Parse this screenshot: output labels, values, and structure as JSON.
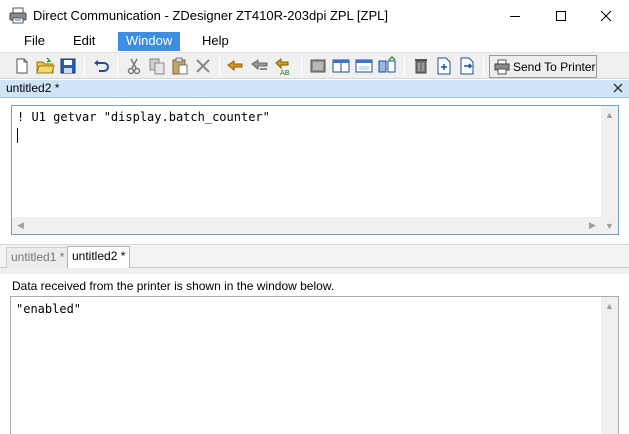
{
  "window": {
    "title": "Direct Communication - ZDesigner ZT410R-203dpi ZPL [ZPL]",
    "app_icon": "printer-icon"
  },
  "menu": {
    "items": [
      {
        "label": "File",
        "active": false
      },
      {
        "label": "Edit",
        "active": false
      },
      {
        "label": "Window",
        "active": true
      },
      {
        "label": "Help",
        "active": false
      }
    ]
  },
  "toolbar": {
    "buttons": [
      "new-icon",
      "open-icon",
      "save-icon",
      "undo-icon",
      "cut-icon",
      "copy-icon",
      "paste-icon",
      "delete-icon",
      "find-icon",
      "find-next-icon",
      "replace-icon",
      "layout-1-icon",
      "layout-2-icon",
      "layout-3-icon",
      "layout-4-icon",
      "clear-icon",
      "import-icon",
      "export-icon",
      "send-to-printer-icon"
    ],
    "send_label": "Send To Printer"
  },
  "document": {
    "title": "untitled2 *",
    "command_text": "! U1 getvar \"display.batch_counter\""
  },
  "tabs": [
    {
      "label": "untitled1 *",
      "active": false
    },
    {
      "label": "untitled2 *",
      "active": true
    }
  ],
  "output": {
    "label": "Data received from the printer is shown in the window below.",
    "text": "\"enabled\""
  },
  "colors": {
    "menu_active_bg": "#3b8ee2",
    "doc_header_bg": "#cfe4f7",
    "editor_border": "#7a9cc4"
  }
}
